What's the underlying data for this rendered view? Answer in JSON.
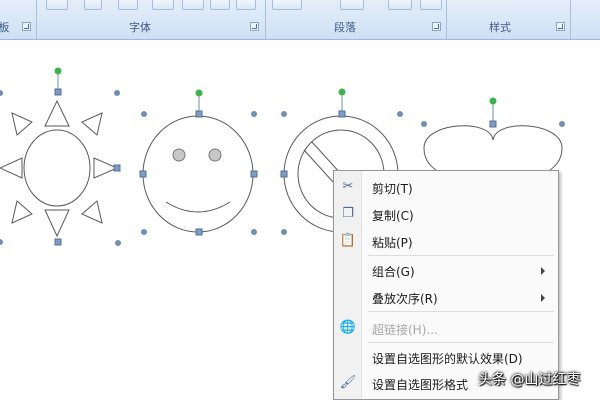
{
  "ribbon": {
    "groups": [
      {
        "id": "clipboard",
        "label": "板"
      },
      {
        "id": "font",
        "label": "字体"
      },
      {
        "id": "paragraph",
        "label": "段落"
      },
      {
        "id": "styles",
        "label": "样式"
      }
    ]
  },
  "context_menu": {
    "items": [
      {
        "label": "剪切(T)",
        "icon": "scissors-icon",
        "enabled": true,
        "submenu": false
      },
      {
        "label": "复制(C)",
        "icon": "copy-icon",
        "enabled": true,
        "submenu": false
      },
      {
        "label": "粘贴(P)",
        "icon": "paste-icon",
        "enabled": true,
        "submenu": false
      },
      {
        "label": "组合(G)",
        "icon": "",
        "enabled": true,
        "submenu": true
      },
      {
        "label": "叠放次序(R)",
        "icon": "",
        "enabled": true,
        "submenu": true
      },
      {
        "label": "超链接(H)...",
        "icon": "hyperlink-icon",
        "enabled": false,
        "submenu": false
      },
      {
        "label": "设置自选图形的默认效果(D)",
        "icon": "",
        "enabled": true,
        "submenu": false
      },
      {
        "label": "设置自选图形格式",
        "icon": "format-shape-icon",
        "enabled": true,
        "submenu": false
      }
    ]
  },
  "watermark": {
    "text": "头条 @山过红枣"
  },
  "colors": {
    "handle_blue": "#6f8fb7",
    "rotate_green": "#3bb54a",
    "shape_stroke": "#5a5a5a",
    "eye_fill": "#c8c8c8"
  }
}
